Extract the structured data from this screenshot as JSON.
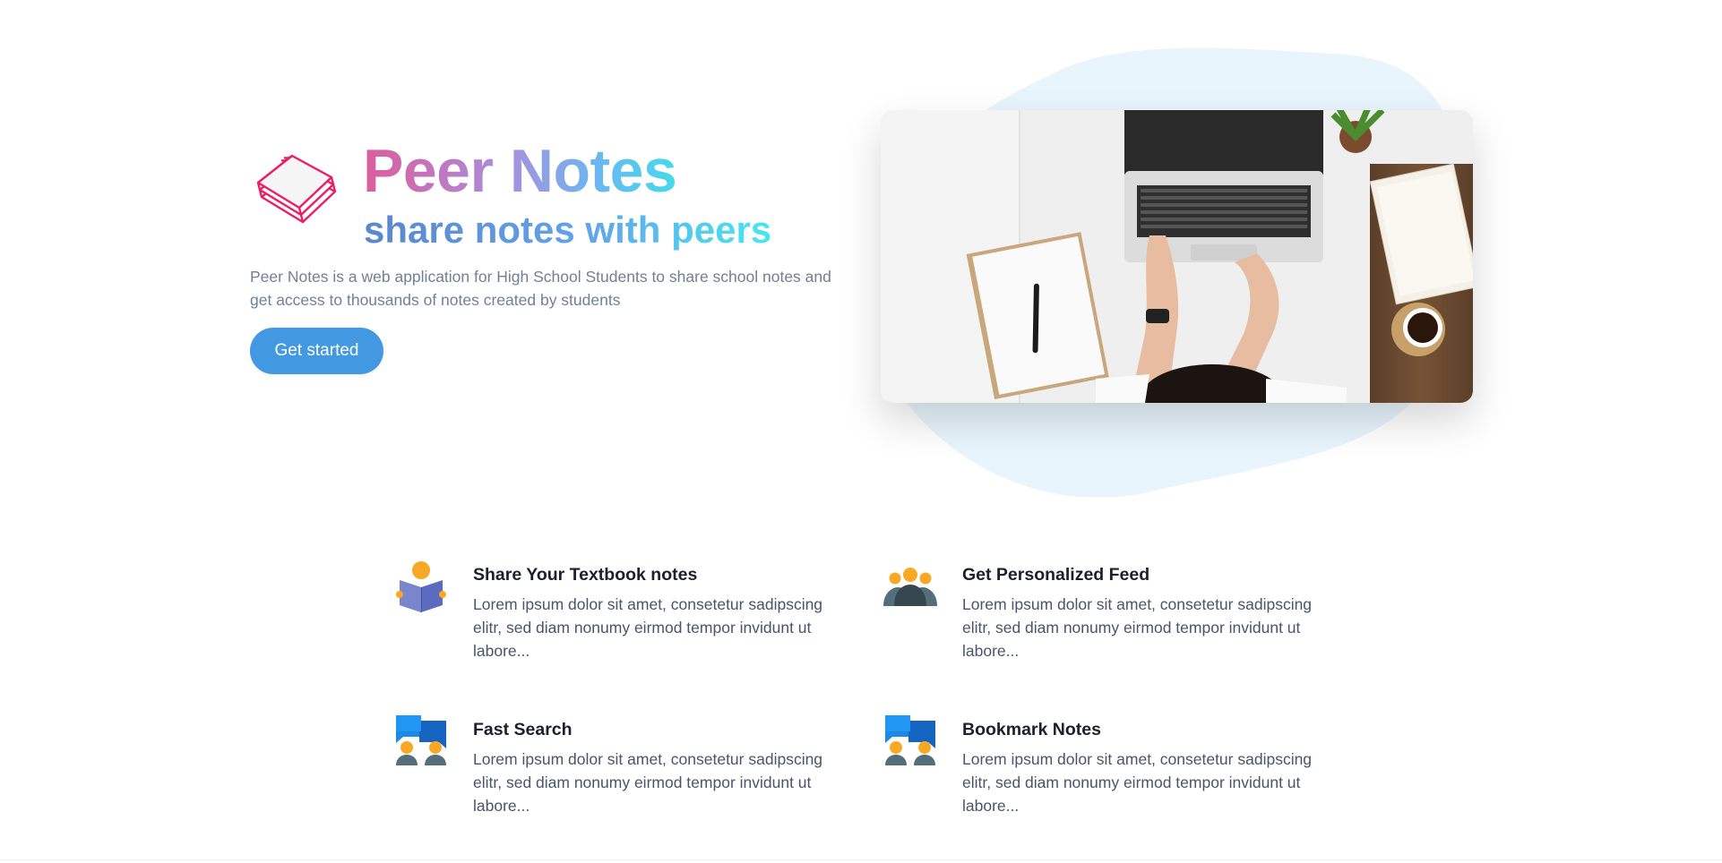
{
  "hero": {
    "title": "Peer Notes",
    "subtitle": "share notes with peers",
    "description": "Peer Notes is a web application for High School Students to share school notes and get access to thousands of notes created by students",
    "cta_label": "Get started",
    "logo_icon": "notepad-icon",
    "image": "laptop-desk-photo"
  },
  "features": [
    {
      "icon": "reading-book-icon",
      "title": "Share Your Textbook notes",
      "body": "Lorem ipsum dolor sit amet, consetetur sadipscing elitr, sed diam nonumy eirmod tempor invidunt ut labore..."
    },
    {
      "icon": "group-icon",
      "title": "Get Personalized Feed",
      "body": "Lorem ipsum dolor sit amet, consetetur sadipscing elitr, sed diam nonumy eirmod tempor invidunt ut labore..."
    },
    {
      "icon": "chat-people-icon",
      "title": "Fast Search",
      "body": "Lorem ipsum dolor sit amet, consetetur sadipscing elitr, sed diam nonumy eirmod tempor invidunt ut labore..."
    },
    {
      "icon": "chat-people-icon",
      "title": "Bookmark Notes",
      "body": "Lorem ipsum dolor sit amet, consetetur sadipscing elitr, sed diam nonumy eirmod tempor invidunt ut labore..."
    }
  ],
  "colors": {
    "accent": "#4299e1",
    "logo": "#e91e63",
    "blob": "#e9f5fd",
    "icon_yellow": "#f9a825",
    "icon_blue": "#1e88e5",
    "icon_slate": "#546e7a"
  }
}
